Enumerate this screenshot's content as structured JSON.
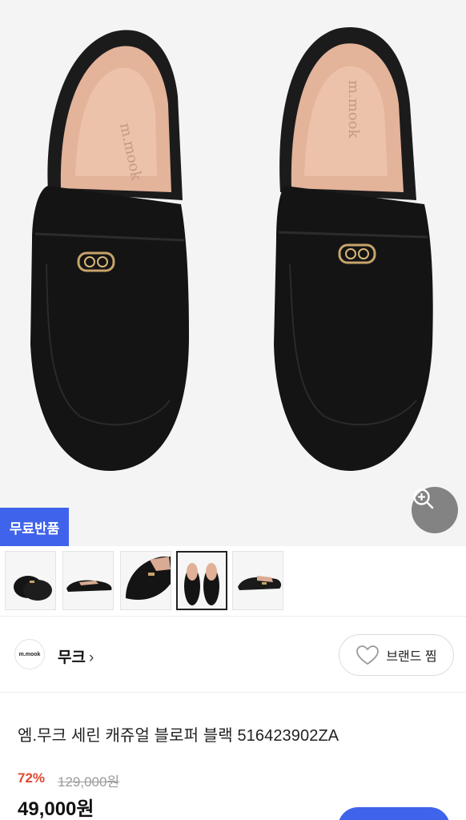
{
  "product": {
    "badge": "무료반품",
    "title": "엠.무크 세린 캐쥬얼 블로퍼 블랙 516423902ZA",
    "discount": "72%",
    "original_price": "129,000원",
    "price": "49,000원",
    "insole_logo": "m.mook"
  },
  "brand": {
    "logo_text": "m.mook",
    "name": "무크",
    "chevron": "›",
    "like_label": "브랜드 찜"
  },
  "thumbnails": [
    {
      "view": "side-pair"
    },
    {
      "view": "side-single"
    },
    {
      "view": "top-angle"
    },
    {
      "view": "top-pair",
      "selected": true
    },
    {
      "view": "side-detail"
    }
  ],
  "icons": {
    "zoom": "zoom-in-icon",
    "heart": "heart-icon"
  },
  "colors": {
    "accent": "#3f63ea",
    "discount": "#e0492f"
  }
}
